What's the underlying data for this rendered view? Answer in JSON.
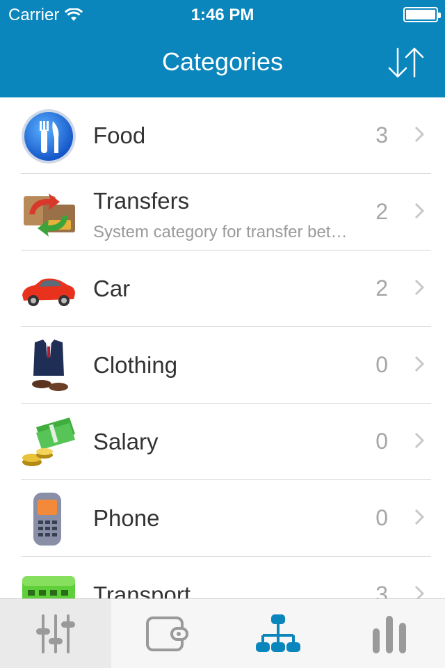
{
  "status_bar": {
    "carrier": "Carrier",
    "time": "1:46 PM"
  },
  "header": {
    "title": "Categories",
    "sort_icon": "sort-arrows-icon"
  },
  "categories": [
    {
      "name": "Food",
      "subtitle": "",
      "count": "3",
      "icon": "food-icon"
    },
    {
      "name": "Transfers",
      "subtitle": "System category for transfer between accounts",
      "count": "2",
      "icon": "transfers-icon"
    },
    {
      "name": "Car",
      "subtitle": "",
      "count": "2",
      "icon": "car-icon"
    },
    {
      "name": "Clothing",
      "subtitle": "",
      "count": "0",
      "icon": "clothing-icon"
    },
    {
      "name": "Salary",
      "subtitle": "",
      "count": "0",
      "icon": "salary-icon"
    },
    {
      "name": "Phone",
      "subtitle": "",
      "count": "0",
      "icon": "phone-icon"
    },
    {
      "name": "Transport",
      "subtitle": "",
      "count": "3",
      "icon": "transport-icon"
    }
  ],
  "tab_bar": {
    "tabs": [
      {
        "icon": "sliders-icon",
        "selected": false
      },
      {
        "icon": "wallet-icon",
        "selected": false
      },
      {
        "icon": "hierarchy-icon",
        "selected": true
      },
      {
        "icon": "bar-chart-icon",
        "selected": false
      }
    ]
  },
  "colors": {
    "accent": "#0a86bd",
    "count_text": "#a6a6a6",
    "subtitle_text": "#9a9a9a",
    "tab_inactive": "#9a9a9a",
    "tab_active": "#0a86bd"
  }
}
